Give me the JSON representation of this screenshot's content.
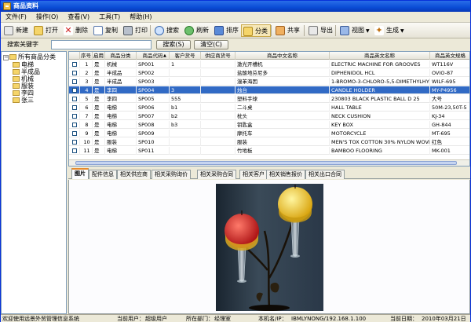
{
  "window": {
    "title": "商品资料"
  },
  "menu": [
    "文件(F)",
    "操作(O)",
    "查看(V)",
    "工具(T)",
    "帮助(H)"
  ],
  "toolbar": {
    "new": "新建",
    "open": "打开",
    "delete": "删除",
    "copy": "复制",
    "print": "打印",
    "search": "搜索",
    "refresh": "刷新",
    "sort": "排序",
    "category": "分类",
    "share": "共享",
    "export": "导出",
    "view": "视图",
    "generate": "生成"
  },
  "search": {
    "label": "搜索关键字",
    "value": "",
    "search_button": "搜索(S)",
    "clear_button": "清空(C)"
  },
  "tree": {
    "root": "所有商品分类",
    "children": [
      "电梯",
      "半成品",
      "机械",
      "服装",
      "李四",
      "张三"
    ]
  },
  "table": {
    "headers": [
      "",
      "序号",
      "启用",
      "商品分类",
      "商品代码",
      "客户货号",
      "供应商货号",
      "商品中文名称",
      "商品英文名称",
      "商品英文规格"
    ],
    "rows": [
      [
        "1",
        "是",
        "机械",
        "SP001",
        "1",
        "",
        "激光开槽机",
        "ELECTRIC MACHINE FOR GROOVES",
        "WT116V"
      ],
      [
        "2",
        "是",
        "半成品",
        "SP002",
        "",
        "",
        "盐酸地芬尼多",
        "DIPHENIDOL HCL",
        "OVIO-87"
      ],
      [
        "3",
        "是",
        "半成品",
        "SP003",
        "",
        "",
        "溴苯海因",
        "1-BROMO-3-CHLORO-5,5-DIMETHYLHY",
        "WILF-695"
      ],
      [
        "4",
        "是",
        "李四",
        "SP004",
        "3",
        "",
        "烛台",
        "CANDLE HOLDER",
        "MY-P4956"
      ],
      [
        "5",
        "是",
        "李四",
        "SP005",
        "555",
        "",
        "塑料手球",
        "230803 BLACK PLASTIC BALL D 25",
        "大号"
      ],
      [
        "6",
        "是",
        "电梯",
        "SP006",
        "b1",
        "",
        "二斗桌",
        "HALL TABLE",
        "50M-23,50T-5"
      ],
      [
        "7",
        "是",
        "电梯",
        "SP007",
        "b2",
        "",
        "枕头",
        "NECK CUSHION",
        "KJ-34"
      ],
      [
        "8",
        "是",
        "电梯",
        "SP008",
        "b3",
        "",
        "钥匙盒",
        "KEY BOX",
        "GH-844"
      ],
      [
        "9",
        "是",
        "电梯",
        "SP009",
        "",
        "",
        "摩托车",
        "MOTORCYCLE",
        "MT-695"
      ],
      [
        "10",
        "是",
        "服装",
        "SP010",
        "",
        "",
        "服装",
        "MEN'S TOX COTTON 30% NYLON WOVE",
        "红色"
      ],
      [
        "11",
        "是",
        "电梯",
        "SP011",
        "",
        "",
        "竹地板",
        "BAMBOO FLOORING",
        "MK-001"
      ]
    ],
    "selected_index": 3,
    "sorted_column": "商品代码"
  },
  "tabs": [
    "图片",
    "配件信息",
    "相关供应商",
    "相关采购询价",
    "相关采购合同",
    "相关客户",
    "相关销售报价",
    "相关出口合同"
  ],
  "active_tab": 0,
  "status": {
    "welcome": "欢迎使用远景外贸管理信息系统",
    "user_label": "当前用户：",
    "user": "超级用户",
    "dept_label": "所在部门：",
    "dept": "经理室",
    "host_label": "本机名/IP：",
    "host": "IBMLYNONG/192.168.1.100",
    "date_label": "当前日期：",
    "date": "2010年03月21日"
  },
  "colors": {
    "titlebar": "#0a4cd6",
    "selection": "#316ac5",
    "tab_accent": "#e68b2c"
  }
}
